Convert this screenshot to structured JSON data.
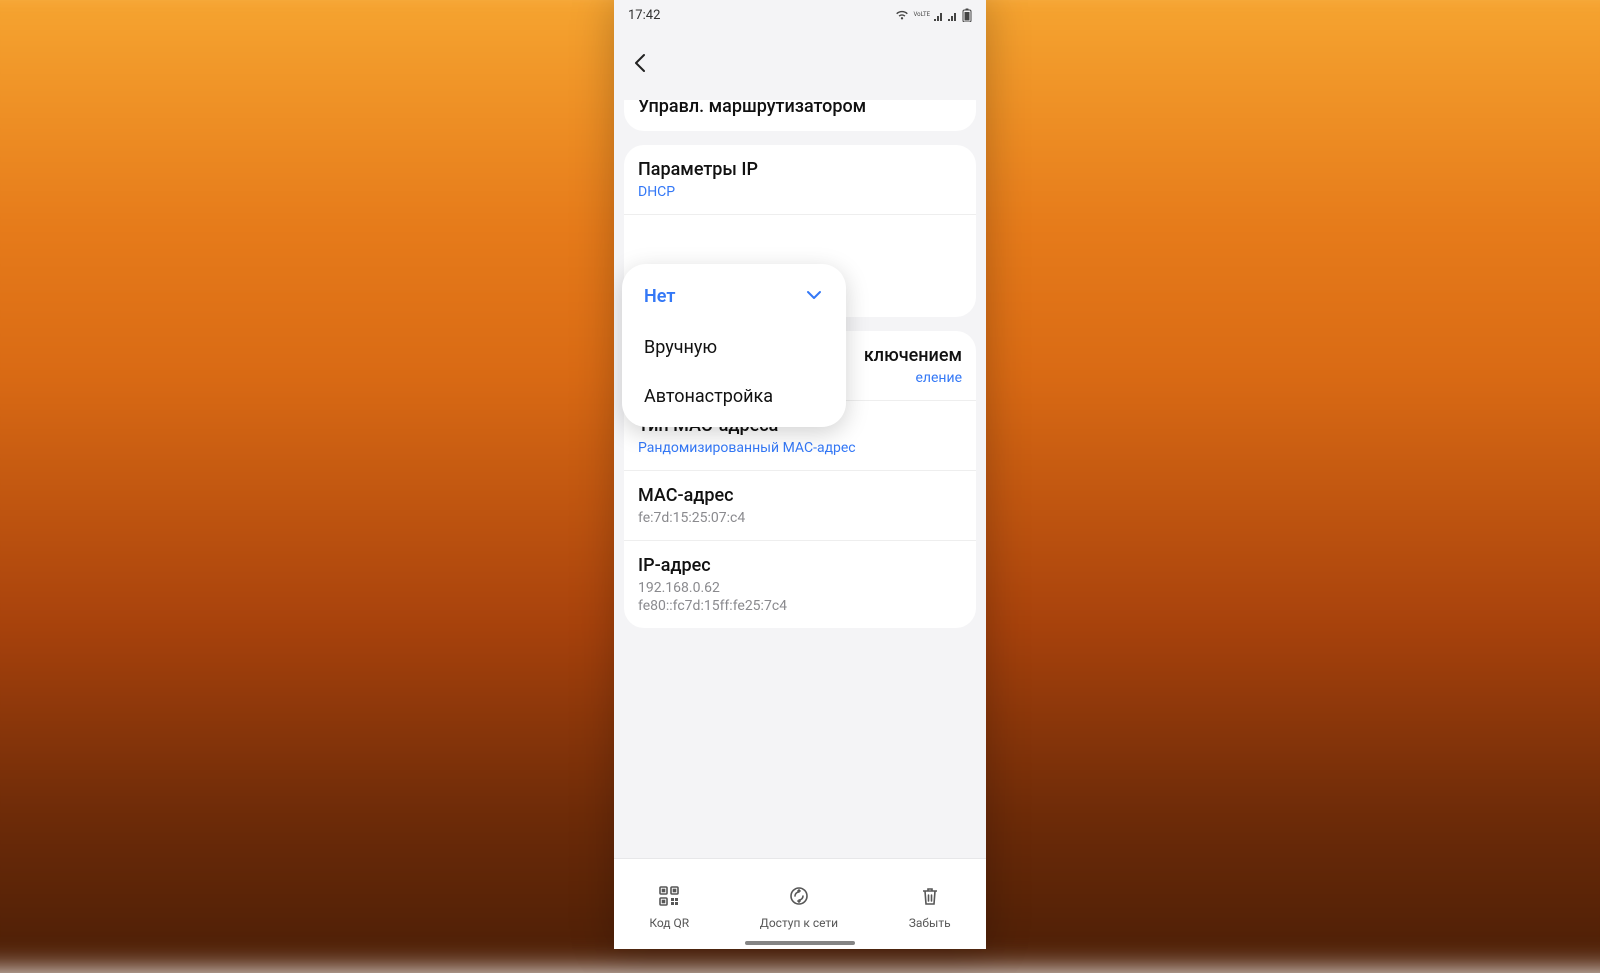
{
  "status": {
    "time": "17:42"
  },
  "rows": {
    "router": "Управл. маршрутизатором",
    "ip_params_title": "Параметры IP",
    "ip_params_value": "DHCP",
    "connection_title_tail": "ключением",
    "connection_value_tail": "еление",
    "mac_type_title": "Тип MAC-адреса",
    "mac_type_value": "Рандомизированный MAC-адрес",
    "mac_title": "MAC-адрес",
    "mac_value": "fe:7d:15:25:07:c4",
    "ip_title": "IP-адрес",
    "ip_value_1": "192.168.0.62",
    "ip_value_2": "fe80::fc7d:15ff:fe25:7c4"
  },
  "dropdown": {
    "options": [
      {
        "label": "Нет",
        "selected": true
      },
      {
        "label": "Вручную",
        "selected": false
      },
      {
        "label": "Автонастройка",
        "selected": false
      }
    ]
  },
  "bottom": {
    "qr": "Код QR",
    "share": "Доступ к сети",
    "forget": "Забыть"
  }
}
